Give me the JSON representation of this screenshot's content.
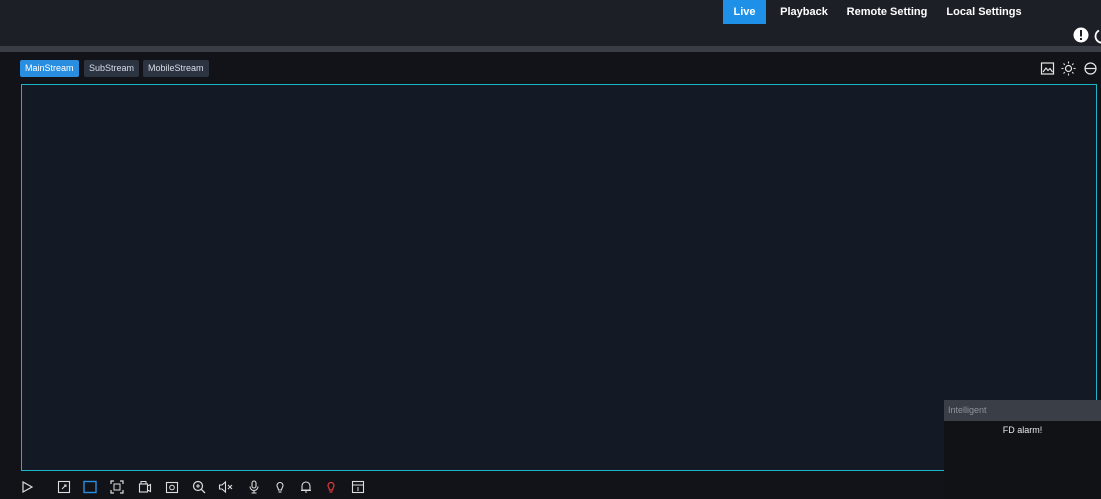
{
  "nav": {
    "items": [
      {
        "label": "Live",
        "active": true
      },
      {
        "label": "Playback",
        "active": false
      },
      {
        "label": "Remote Setting",
        "active": false
      },
      {
        "label": "Local Settings",
        "active": false
      }
    ]
  },
  "header_icons": [
    "info-icon",
    "power-icon"
  ],
  "streams": [
    {
      "label": "MainStream",
      "active": true
    },
    {
      "label": "SubStream",
      "active": false
    },
    {
      "label": "MobileStream",
      "active": false
    }
  ],
  "toolbar_icons": [
    "image-settings-icon",
    "brightness-icon",
    "ptz-icon"
  ],
  "intelligent": {
    "header": "Intelligent",
    "items": [
      "FD alarm!"
    ]
  },
  "bottom_icons": [
    "play-icon",
    "window-layout-icon",
    "aspect-ratio-icon",
    "fullscreen-icon",
    "record-icon",
    "snapshot-icon",
    "zoom-in-icon",
    "mute-icon",
    "microphone-icon",
    "light-icon",
    "alarm-icon",
    "red-light-icon",
    "panel-icon"
  ],
  "colors": {
    "accent": "#1e90e8",
    "video_border": "#1ab5c6",
    "alert_icon": "#e23b3b"
  }
}
